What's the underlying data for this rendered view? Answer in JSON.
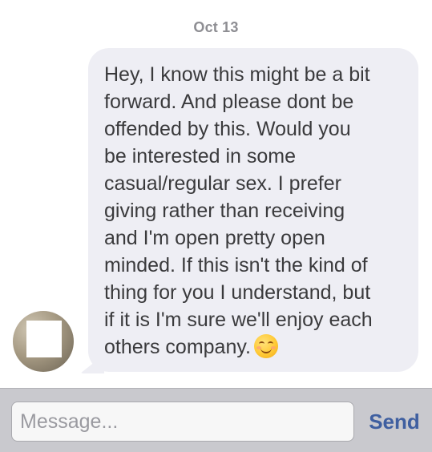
{
  "conversation": {
    "date_label": "Oct 13",
    "message": {
      "lines": [
        "Hey, I know this might be a bit",
        "forward. And please dont be",
        "offended by this. Would you",
        "be interested in some",
        "casual/regular sex. I prefer",
        "giving rather than receiving",
        "and I'm open pretty open",
        "minded. If this isn't the kind of",
        "thing for you I understand, but",
        "if it is I'm sure we'll enjoy each",
        "others company."
      ],
      "emoji": "smiling-face-icon"
    }
  },
  "composer": {
    "placeholder": "Message...",
    "value": "",
    "send_label": "Send"
  },
  "colors": {
    "bubble_background": "#eeeef4",
    "send_accent": "#3f5fa0",
    "input_bar_background": "#c9c9ce"
  }
}
